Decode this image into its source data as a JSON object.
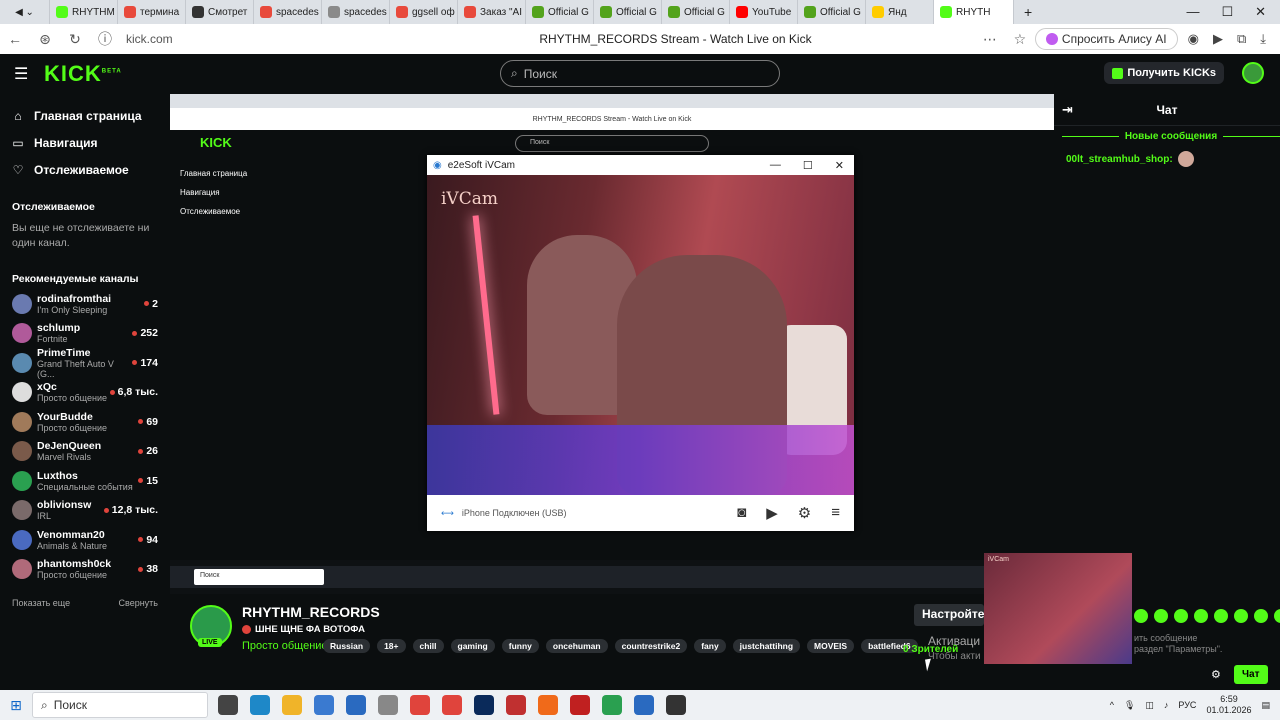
{
  "browser": {
    "tabs": [
      "RHYTHM",
      "термина",
      "Смотрет",
      "spacedes",
      "spacedes",
      "ggsell оф",
      "Заказ \"AI",
      "Official G",
      "Official G",
      "Official G",
      "YouTube",
      "Official G",
      "Янд",
      "RHYTH"
    ],
    "tab_colors": [
      "#53fc18",
      "#e84a3c",
      "#333333",
      "#e84a3c",
      "#8a8a8a",
      "#e84a3c",
      "#e84a3c",
      "#53a31c",
      "#53a31c",
      "#53a31c",
      "#ff0000",
      "#53a31c",
      "#ffcc00",
      "#53fc18"
    ],
    "url": "kick.com",
    "page_title": "RHYTHM_RECORDS Stream - Watch Live on Kick",
    "alice_label": "Спросить Алису AI"
  },
  "kick": {
    "logo": "KICK",
    "logo_sup": "BETA",
    "search_placeholder": "Поиск",
    "get_kicks": "Получить KICKs",
    "nav": [
      "Главная страница",
      "Навигация",
      "Отслеживаемое"
    ],
    "followed_heading": "Отслеживаемое",
    "followed_empty": "Вы еще не отслеживаете ни один канал.",
    "recommended_heading": "Рекомендуемые каналы",
    "channels": [
      {
        "name": "rodinafromthai",
        "category": "I'm Only Sleeping",
        "count": "2",
        "color": "#6a7ab0"
      },
      {
        "name": "schlump",
        "category": "Fortnite",
        "count": "252",
        "color": "#b05a9a"
      },
      {
        "name": "PrimeTime",
        "category": "Grand Theft Auto V (G...",
        "count": "174",
        "color": "#5a8ab0"
      },
      {
        "name": "xQc",
        "category": "Просто общение",
        "count": "6,8 тыс.",
        "color": "#dddddd"
      },
      {
        "name": "YourBudde",
        "category": "Просто общение",
        "count": "69",
        "color": "#a07a5a"
      },
      {
        "name": "DeJenQueen",
        "category": "Marvel Rivals",
        "count": "26",
        "color": "#7a5a4a"
      },
      {
        "name": "Luxthos",
        "category": "Специальные события",
        "count": "15",
        "color": "#2aa050"
      },
      {
        "name": "oblivionsw",
        "category": "IRL",
        "count": "12,8 тыс.",
        "color": "#7a6a6a"
      },
      {
        "name": "Venomman20",
        "category": "Animals & Nature",
        "count": "94",
        "color": "#4a6ac0"
      },
      {
        "name": "phantomsh0ck",
        "category": "Просто общение",
        "count": "38",
        "color": "#b06a7a"
      }
    ],
    "show_more": "Показать еще",
    "collapse": "Свернуть"
  },
  "ivcam": {
    "window_title": "e2eSoft iVCam",
    "overlay_label": "iVCam",
    "status": "iPhone Подключен (USB)"
  },
  "inner": {
    "title": "RHYTHM_RECORDS Stream - Watch Live on Kick",
    "url": "kick.com",
    "search": "Поиск",
    "nav": [
      "Главная страница",
      "Навигация",
      "Отслеживаемое"
    ],
    "taskbar_search": "Поиск"
  },
  "chat": {
    "title": "Чат",
    "new_messages": "Новые сообщения",
    "message_user": "00lt_streamhub_shop:",
    "input_placeholder": "ить сообщение\nраздел \"Параметры\".",
    "send": "Чат"
  },
  "stream": {
    "streamer": "RHYTHM_RECORDS",
    "title": "ШНЕ ЩНЕ ФА ВОТОФА",
    "live": "LIVE",
    "category": "Просто общение",
    "tags": [
      "Russian",
      "18+",
      "chill",
      "gaming",
      "funny",
      "oncehuman",
      "countrestrike2",
      "fany",
      "justchattihng",
      "MOVEIS",
      "battlefied6"
    ],
    "viewers": "0 Зрителей"
  },
  "overlay": {
    "toast": "Настройте к",
    "activation": "Активаци",
    "activation_sub": "Чтобы акти"
  },
  "pip": {
    "label": "iVCam"
  },
  "taskbar": {
    "search": "Поиск",
    "lang": "РУС",
    "time": "6:59",
    "date": "01.01.2026"
  }
}
